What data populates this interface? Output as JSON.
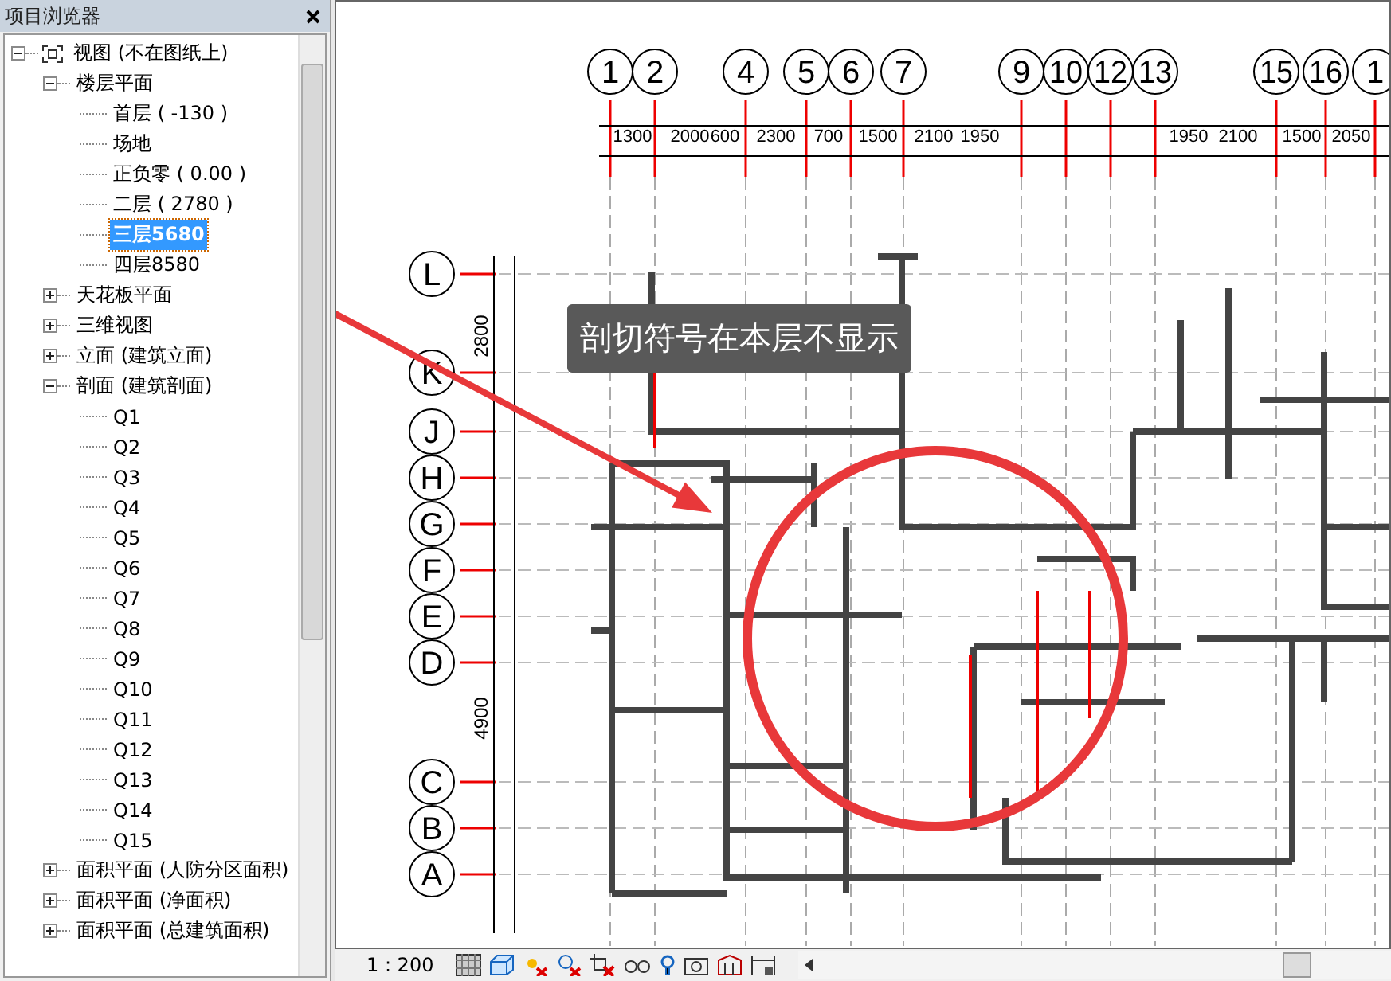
{
  "browser": {
    "title": "项目浏览器",
    "tree": [
      {
        "label": "视图 (不在图纸上)",
        "kind": "root",
        "expanded": true,
        "selected": false,
        "children": [
          {
            "label": "楼层平面",
            "expanded": true,
            "selected": false,
            "children": [
              {
                "label": "首层 ( -130 )",
                "selected": false
              },
              {
                "label": "场地",
                "selected": false
              },
              {
                "label": "正负零 ( 0.00 )",
                "selected": false
              },
              {
                "label": "二层 ( 2780 )",
                "selected": false
              },
              {
                "label": "三层5680",
                "selected": true
              },
              {
                "label": "四层8580",
                "selected": false
              }
            ]
          },
          {
            "label": "天花板平面",
            "expanded": false,
            "selected": false
          },
          {
            "label": "三维视图",
            "expanded": false,
            "selected": false
          },
          {
            "label": "立面 (建筑立面)",
            "expanded": false,
            "selected": false
          },
          {
            "label": "剖面 (建筑剖面)",
            "expanded": true,
            "selected": false,
            "children": [
              {
                "label": "Q1",
                "selected": false
              },
              {
                "label": "Q2",
                "selected": false
              },
              {
                "label": "Q3",
                "selected": false
              },
              {
                "label": "Q4",
                "selected": false
              },
              {
                "label": "Q5",
                "selected": false
              },
              {
                "label": "Q6",
                "selected": false
              },
              {
                "label": "Q7",
                "selected": false
              },
              {
                "label": "Q8",
                "selected": false
              },
              {
                "label": "Q9",
                "selected": false
              },
              {
                "label": "Q10",
                "selected": false
              },
              {
                "label": "Q11",
                "selected": false
              },
              {
                "label": "Q12",
                "selected": false
              },
              {
                "label": "Q13",
                "selected": false
              },
              {
                "label": "Q14",
                "selected": false
              },
              {
                "label": "Q15",
                "selected": false
              }
            ]
          },
          {
            "label": "面积平面 (人防分区面积)",
            "expanded": false,
            "selected": false
          },
          {
            "label": "面积平面 (净面积)",
            "expanded": false,
            "selected": false
          },
          {
            "label": "面积平面 (总建筑面积)",
            "expanded": false,
            "selected": false
          }
        ]
      }
    ]
  },
  "canvas": {
    "tooltip": "剖切符号在本层不显示",
    "grid_columns": [
      "1",
      "2",
      "4",
      "5",
      "6",
      "7",
      "9",
      "10",
      "12",
      "13",
      "15",
      "16",
      "1"
    ],
    "grid_rows": [
      "L",
      "K",
      "J",
      "H",
      "G",
      "F",
      "E",
      "D",
      "C",
      "B",
      "A"
    ],
    "dimensions_horizontal": [
      "1300",
      "2000",
      "600",
      "2300",
      "700",
      "1500",
      "2100",
      "1950",
      "1950",
      "2100",
      "1500",
      "2050"
    ],
    "dimensions_vertical": [
      "2800",
      "4900"
    ]
  },
  "status_bar": {
    "scale": "1 : 200"
  }
}
